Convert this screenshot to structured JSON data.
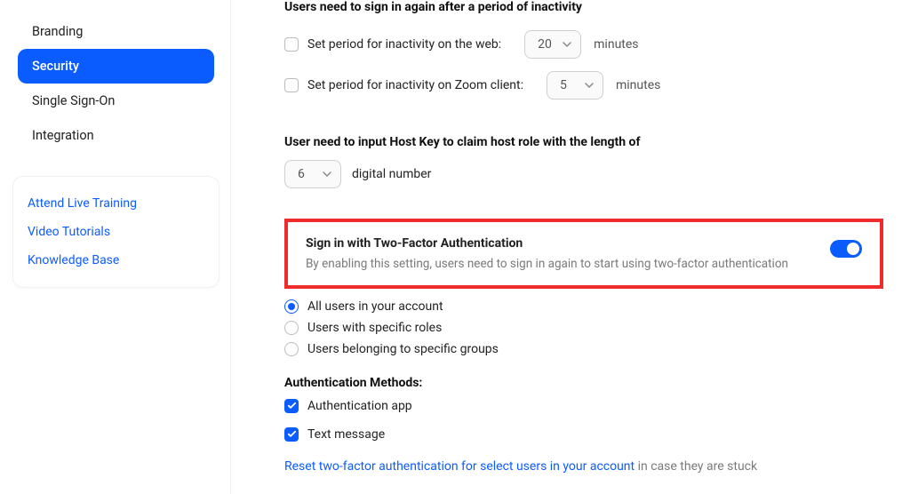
{
  "sidebar": {
    "nav": [
      {
        "label": "Branding",
        "active": false
      },
      {
        "label": "Security",
        "active": true
      },
      {
        "label": "Single Sign-On",
        "active": false
      },
      {
        "label": "Integration",
        "active": false
      }
    ],
    "help": [
      {
        "label": "Attend Live Training"
      },
      {
        "label": "Video Tutorials"
      },
      {
        "label": "Knowledge Base"
      }
    ]
  },
  "inactivity": {
    "title": "Users need to sign in again after a period of inactivity",
    "web_label": "Set period for inactivity on the web:",
    "web_value": "20",
    "client_label": "Set period for inactivity on Zoom client:",
    "client_value": "5",
    "unit": "minutes"
  },
  "hostkey": {
    "title": "User need to input Host Key to claim host role with the length of",
    "value": "6",
    "unit": "digital number"
  },
  "twofa": {
    "title": "Sign in with Two-Factor Authentication",
    "description": "By enabling this setting, users need to sign in again to start using two-factor authentication",
    "enabled": true,
    "scope": {
      "options": [
        {
          "label": "All users in your account",
          "selected": true
        },
        {
          "label": "Users with specific roles",
          "selected": false
        },
        {
          "label": "Users belonging to specific groups",
          "selected": false
        }
      ]
    },
    "methods_title": "Authentication Methods:",
    "methods": [
      {
        "label": "Authentication app",
        "checked": true
      },
      {
        "label": "Text message",
        "checked": true
      }
    ],
    "reset_link": "Reset two-factor authentication for select users in your account",
    "reset_suffix": "in case they are stuck"
  }
}
